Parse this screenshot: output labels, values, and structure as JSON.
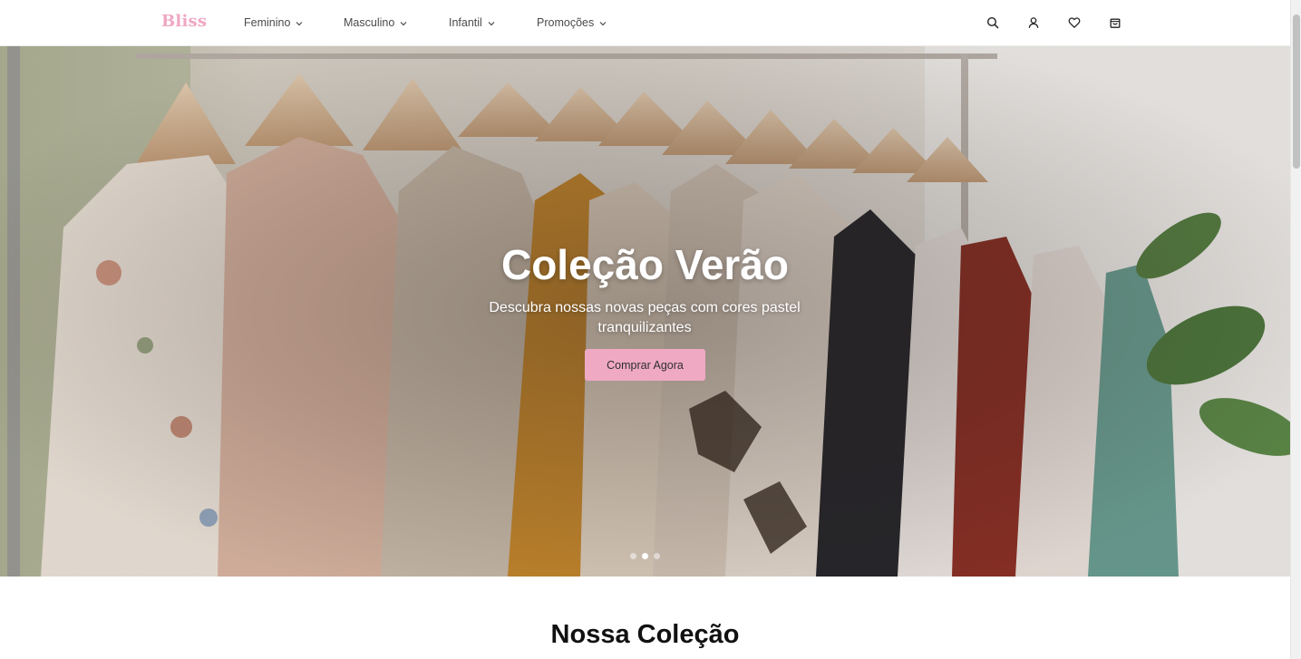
{
  "brand": {
    "name": "Bliss",
    "color": "#f0a7c4"
  },
  "nav": {
    "items": [
      {
        "label": "Feminino",
        "icon": "chevron-down-icon"
      },
      {
        "label": "Masculino",
        "icon": "chevron-down-icon"
      },
      {
        "label": "Infantil",
        "icon": "chevron-down-icon"
      },
      {
        "label": "Promoções",
        "icon": "chevron-down-icon"
      }
    ]
  },
  "header_actions": [
    "search-icon",
    "user-icon",
    "heart-icon",
    "shopping-bag-icon"
  ],
  "hero": {
    "title": "Coleção Verão",
    "subtitle": "Descubra nossas novas peças com cores pastel tranquilizantes",
    "cta_label": "Comprar Agora",
    "cta_color": "#f0a9c3",
    "slides_count": 3,
    "active_slide": 2
  },
  "collection": {
    "title": "Nossa Coleção"
  }
}
